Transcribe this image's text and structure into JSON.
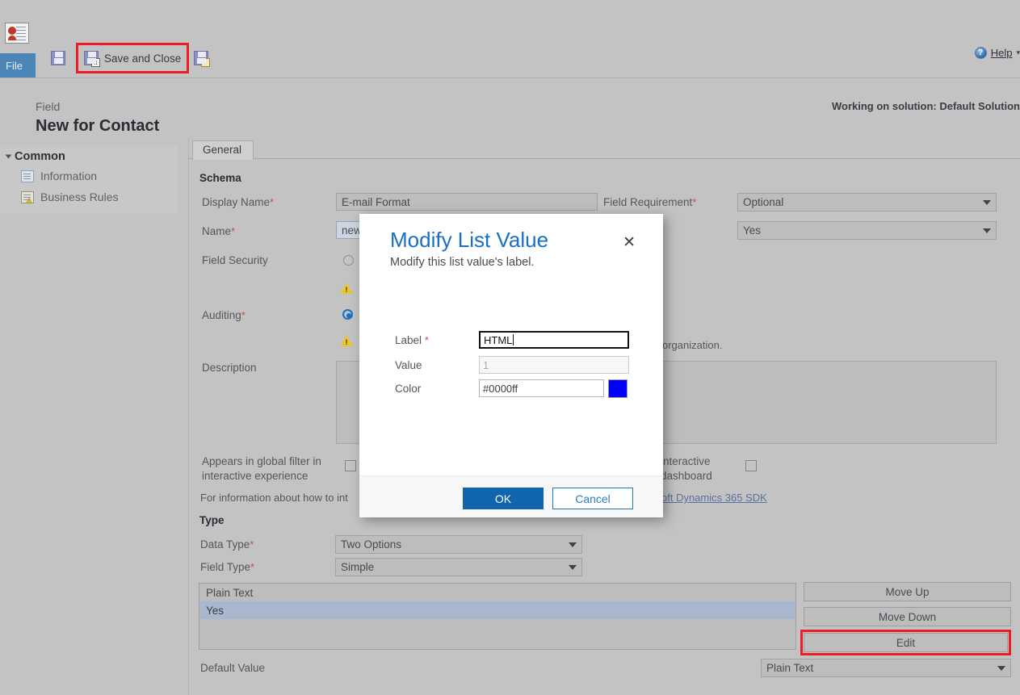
{
  "ribbon": {
    "file_tab": "File",
    "save_button_label": "",
    "save_and_close_label": "Save and Close",
    "save_as_label": "",
    "help_label": "Help",
    "help_caret": "▾"
  },
  "header": {
    "entity_kind": "Field",
    "entity_title": "New for Contact",
    "solution_note": "Working on solution: Default Solution"
  },
  "sidebar": {
    "group_label": "Common",
    "items": [
      {
        "label": "Information"
      },
      {
        "label": "Business Rules"
      }
    ]
  },
  "main": {
    "tab_label": "General",
    "schema_section": "Schema",
    "display_name_label": "Display Name",
    "display_name_value": "E-mail Format",
    "name_label": "Name",
    "name_value": "new",
    "field_security_label": "Field Security",
    "auditing_label": "Auditing",
    "description_label": "Description",
    "description_value": "",
    "field_requirement_label": "Field Requirement",
    "field_requirement_value": "Optional",
    "searchable_value": "Yes",
    "organization_text": "organization.",
    "global_filter_label_line1": "Appears in global filter in",
    "global_filter_label_line2": "interactive experience",
    "dashboard_label_line1": "interactive",
    "dashboard_label_line2": "dashboard",
    "info_text_prefix": "For information about how to int",
    "sdk_link_text": "oft Dynamics 365 SDK",
    "type_section": "Type",
    "data_type_label": "Data Type",
    "data_type_value": "Two Options",
    "field_type_label": "Field Type",
    "field_type_value": "Simple",
    "option_list": [
      {
        "label": "Plain Text",
        "selected": false
      },
      {
        "label": "Yes",
        "selected": true
      }
    ],
    "move_up_label": "Move Up",
    "move_down_label": "Move Down",
    "edit_label": "Edit",
    "default_value_label": "Default Value",
    "default_value_value": "Plain Text",
    "required_marker": "*"
  },
  "dialog": {
    "title": "Modify List Value",
    "subtitle": "Modify this list value's label.",
    "close_icon": "✕",
    "label_field_label": "Label",
    "label_field_value": "HTML",
    "value_field_label": "Value",
    "value_field_value": "1",
    "color_field_label": "Color",
    "color_field_value": "#0000ff",
    "color_swatch_hex": "#0000ff",
    "ok_label": "OK",
    "cancel_label": "Cancel",
    "required_marker": "*"
  },
  "colors": {
    "accent_blue": "#1065ad",
    "highlight_red": "#ee1c25",
    "window_gray": "#c3c3c3",
    "selection_blue": "#a7b8cf"
  }
}
